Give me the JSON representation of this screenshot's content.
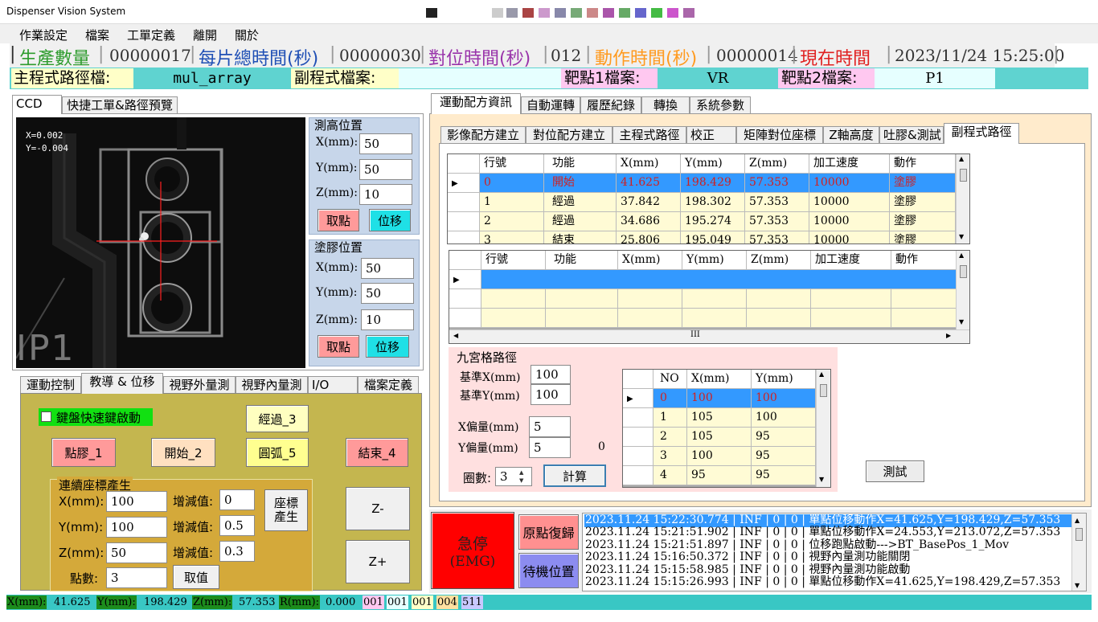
{
  "window": {
    "title": "Dispenser Vision System"
  },
  "menu": [
    "作業設定",
    "檔案",
    "工單定義",
    "離開",
    "關於"
  ],
  "status": {
    "production_label": "生產數量",
    "production_value": "00000017",
    "total_time_label": "每片總時間(秒)",
    "total_time_value": "00000030",
    "align_time_label": "對位時間(秒)",
    "align_time_value": "012",
    "action_time_label": "動作時間(秒)",
    "action_time_value": "00000014",
    "now_label": "現在時間",
    "now_value": "2023/11/24  15:25:00"
  },
  "files": {
    "main_label": "主程式路徑檔:",
    "main_value": "mul_array",
    "sub_label": "副程式檔案:",
    "sub_value": "",
    "target1_label": "靶點1檔案:",
    "target1_value": "VR",
    "target2_label": "靶點2檔案:",
    "target2_value": "P1"
  },
  "left_tabs": [
    "CCD",
    "快捷工單&路徑預覽"
  ],
  "ccd": {
    "x_readout": "X=0.002",
    "y_readout": "Y=-0.004",
    "board_label": "IP1"
  },
  "height_pos": {
    "title": "測高位置",
    "x_label": "X(mm):",
    "x": "50",
    "y_label": "Y(mm):",
    "y": "50",
    "z_label": "Z(mm):",
    "z": "10",
    "get_btn": "取點",
    "move_btn": "位移"
  },
  "glue_pos": {
    "title": "塗膠位置",
    "x_label": "X(mm):",
    "x": "50",
    "y_label": "Y(mm):",
    "y": "50",
    "z_label": "Z(mm):",
    "z": "10",
    "get_btn": "取點",
    "move_btn": "位移"
  },
  "lower_tabs": [
    "運動控制",
    "教導 & 位移",
    "視野外量測",
    "視野內量測",
    "I/O",
    "檔案定義"
  ],
  "teach": {
    "keyboard_label": "鍵盤快速鍵啟動",
    "btn_dispense": "點膠_1",
    "btn_start": "開始_2",
    "btn_pass": "經過_3",
    "btn_arc": "圓弧_5",
    "btn_end": "結束_4",
    "coord_group": "連續座標產生",
    "x_label": "X(mm):",
    "x": "100",
    "y_label": "Y(mm):",
    "y": "100",
    "z_label": "Z(mm):",
    "z": "50",
    "count_label": "點數:",
    "count": "3",
    "inc_label": "增減值:",
    "inc_x": "0",
    "inc_y": "0.5",
    "inc_z": "0.3",
    "gen_btn": "座標產生",
    "get_btn": "取值",
    "zminus": "Z-",
    "zplus": "Z+"
  },
  "right_tabs": [
    "運動配方資訊",
    "自動運轉",
    "履歷紀錄",
    "轉換",
    "系統參數"
  ],
  "sub_tabs": [
    "影像配方建立",
    "對位配方建立",
    "主程式路徑",
    "校正",
    "矩陣對位座標",
    "Z軸高度",
    "吐膠&測試",
    "副程式路徑"
  ],
  "grid1": {
    "headers": [
      "行號",
      "功能",
      "X(mm)",
      "Y(mm)",
      "Z(mm)",
      "加工速度",
      "動作"
    ],
    "rows": [
      [
        "0",
        "開始",
        "41.625",
        "198.429",
        "57.353",
        "10000",
        "塗膠"
      ],
      [
        "1",
        "經過",
        "37.842",
        "198.302",
        "57.353",
        "10000",
        "塗膠"
      ],
      [
        "2",
        "經過",
        "34.686",
        "195.274",
        "57.353",
        "10000",
        "塗膠"
      ],
      [
        "3",
        "結束",
        "25.806",
        "195.049",
        "57.353",
        "10000",
        "塗膠"
      ]
    ]
  },
  "grid2": {
    "headers": [
      "行號",
      "功能",
      "X(mm)",
      "Y(mm)",
      "Z(mm)",
      "加工速度",
      "動作"
    ],
    "scroll_mark": "III"
  },
  "nine": {
    "title": "九宮格路徑",
    "base_x_label": "基準X(mm)",
    "base_x": "100",
    "base_y_label": "基準Y(mm)",
    "base_y": "100",
    "off_x_label": "X偏量(mm)",
    "off_x": "5",
    "off_y_label": "Y偏量(mm)",
    "off_y": "5",
    "zero": "0",
    "laps_label": "圈數:",
    "laps": "3",
    "calc_btn": "計算",
    "test_btn": "測試",
    "headers": [
      "NO",
      "X(mm)",
      "Y(mm)"
    ],
    "rows": [
      [
        "0",
        "100",
        "100"
      ],
      [
        "1",
        "105",
        "100"
      ],
      [
        "2",
        "105",
        "95"
      ],
      [
        "3",
        "100",
        "95"
      ],
      [
        "4",
        "95",
        "95"
      ]
    ]
  },
  "controls": {
    "emg_line1": "急停",
    "emg_line2": "(EMG)",
    "home_btn": "原點復歸",
    "standby_btn": "待機位置"
  },
  "log": [
    "2023.11.24 15:22:30.774 | INF | 0 | 0 | 單點位移動作X=41.625,Y=198.429,Z=57.353",
    "2023.11.24 15:21:51.902 | INF | 0 | 0 | 單點位移動作X=24.553,Y=213.072,Z=57.353",
    "2023.11.24 15:21:51.897 | INF | 0 | 0 | 位移跑點啟動--->BT_BasePos_1_Mov",
    "2023.11.24 15:16:50.372 | INF | 0 | 0 | 視野內量測功能關閉",
    "2023.11.24 15:15:58.985 | INF | 0 | 0 | 視野內量測功能啟動",
    "2023.11.24 15:15:26.993 | INF | 0 | 0 | 單點位移動作X=41.625,Y=198.429,Z=57.353"
  ],
  "bottom": {
    "x_label": "X(mm):",
    "x": "41.625",
    "y_label": "Y(mm):",
    "y": "198.429",
    "z_label": "Z(mm):",
    "z": "57.353",
    "r_label": "R(mm):",
    "r": "0.000",
    "c1": "001",
    "c2": "001",
    "c3": "001",
    "c4": "004",
    "c5": "511"
  },
  "colors": {
    "accent_cyan": "#5fd3d0",
    "emg_red": "#ff0000",
    "selected_row": "#3399ff",
    "grid_row": "#fffbd5",
    "panel_olive": "#c4b64f"
  }
}
